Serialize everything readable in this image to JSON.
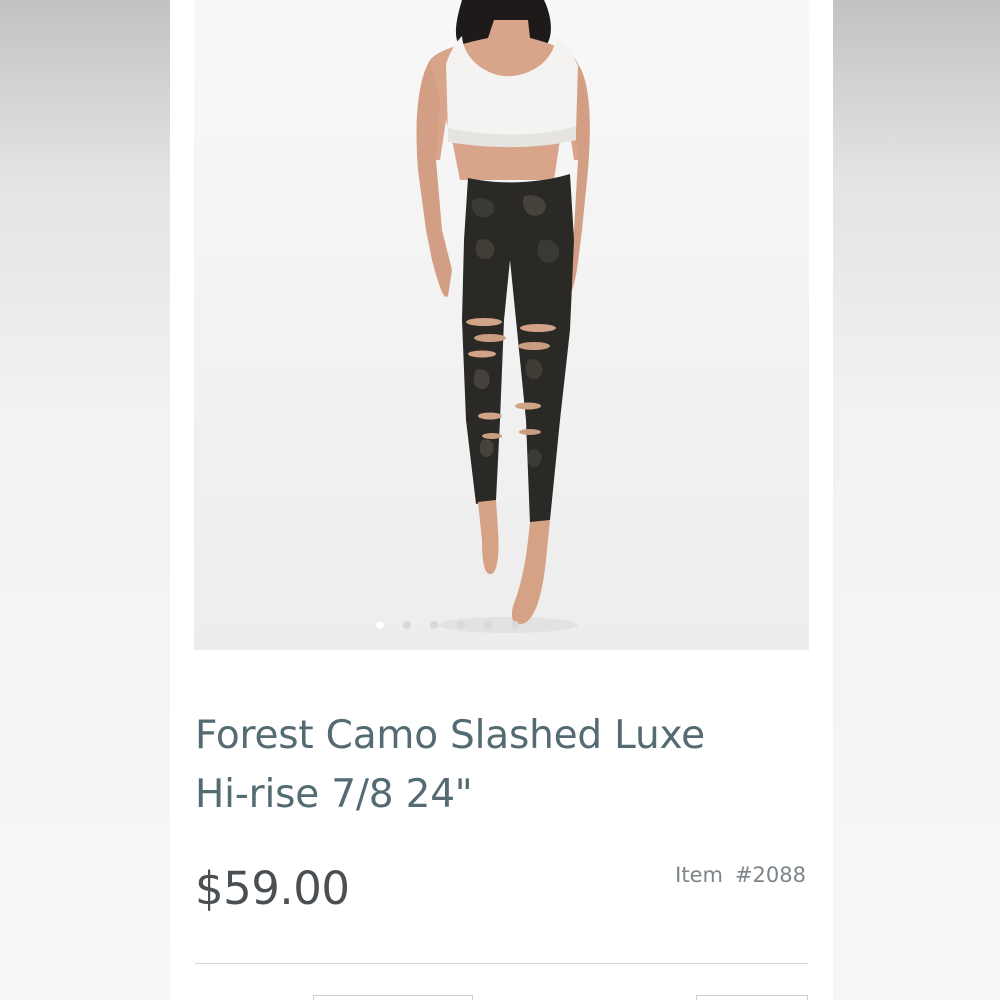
{
  "product": {
    "title_line1": "Forest Camo Slashed Luxe",
    "title_line2": "Hi-rise 7/8 24\"",
    "price": "$59.00",
    "item_label": "Item",
    "item_number": "#2088"
  },
  "gallery": {
    "image_count": 6,
    "active_index": 0,
    "icon": "product-photo"
  },
  "colors": {
    "title": "#546b73",
    "price": "#4a4f53",
    "item": "#7c8589"
  }
}
